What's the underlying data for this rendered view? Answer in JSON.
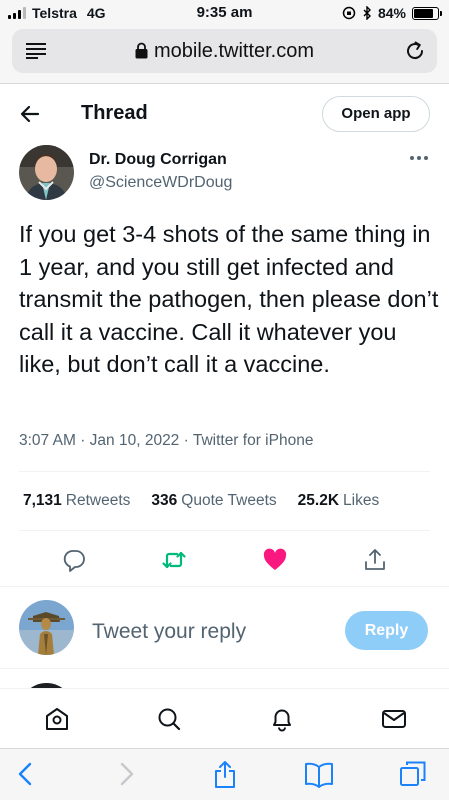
{
  "status_bar": {
    "carrier": "Telstra",
    "network": "4G",
    "time": "9:35 am",
    "battery_percent": "84%",
    "battery_level": 0.84
  },
  "browser": {
    "url": "mobile.twitter.com"
  },
  "header": {
    "title": "Thread",
    "open_app_label": "Open app"
  },
  "tweet": {
    "author_name": "Dr. Doug Corrigan",
    "author_handle": "@ScienceWDrDoug",
    "text": "If you get 3-4 shots of the same thing in 1 year, and you still get infected and transmit the pathogen, then please don’t call it a vaccine. Call it whatever you like, but don’t call it a vaccine.",
    "time": "3:07 AM",
    "separator": "·",
    "date": "Jan 10, 2022",
    "source": "Twitter for iPhone",
    "stats": {
      "retweets_count": "7,131",
      "retweets_label": "Retweets",
      "quotes_count": "336",
      "quotes_label": "Quote Tweets",
      "likes_count": "25.2K",
      "likes_label": "Likes"
    }
  },
  "reply": {
    "placeholder": "Tweet your reply",
    "button_label": "Reply"
  },
  "colors": {
    "retweet": "#00ba7c",
    "like": "#f91880",
    "reply_button": "#8ecdf8",
    "secondary_text": "#536471",
    "safari_blue": "#1a82fb"
  },
  "icons": {
    "nav": [
      "home-icon",
      "search-icon",
      "notifications-bell-icon",
      "messages-envelope-icon"
    ],
    "safari": [
      "back-chevron-icon",
      "forward-chevron-icon",
      "share-icon",
      "bookmarks-book-icon",
      "tabs-icon"
    ]
  }
}
